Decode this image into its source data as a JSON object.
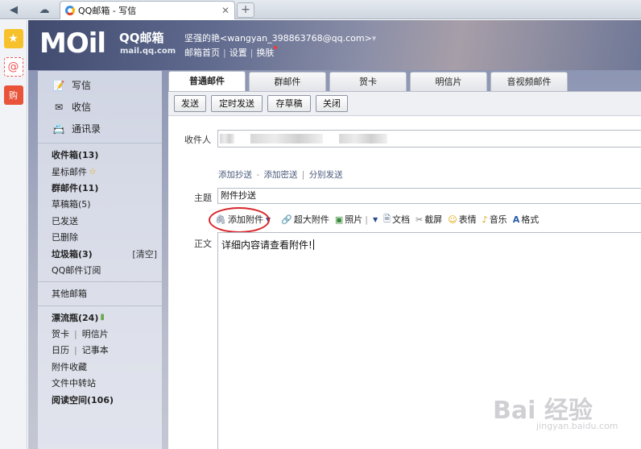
{
  "browser": {
    "tab_title": "QQ邮箱 - 写信",
    "close_glyph": "✕",
    "new_tab_glyph": "+"
  },
  "header": {
    "logo_text": "MOil",
    "brand": "QQ邮箱",
    "brand_url": "mail.qq.com",
    "user_display": "坚强的艳<wangyan_398863768@qq.com>",
    "links": [
      "邮箱首页",
      "设置",
      "换肤"
    ]
  },
  "nav": {
    "main": [
      {
        "label": "写信",
        "icon": "pencil-icon"
      },
      {
        "label": "收信",
        "icon": "inbox-icon"
      },
      {
        "label": "通讯录",
        "icon": "contacts-icon"
      }
    ],
    "folders": [
      {
        "label": "收件箱(13)",
        "bold": true
      },
      {
        "label": "星标邮件",
        "bold": false,
        "star": "☆"
      },
      {
        "label": "群邮件(11)",
        "bold": true
      },
      {
        "label": "草稿箱(5)",
        "bold": false
      },
      {
        "label": "已发送",
        "bold": false
      },
      {
        "label": "已删除",
        "bold": false
      },
      {
        "label": "垃圾箱(3)",
        "bold": true,
        "extra": "[清空]"
      },
      {
        "label": "QQ邮件订阅",
        "bold": false
      }
    ],
    "other": "其他邮箱",
    "apps": [
      {
        "label": "漂流瓶(24)",
        "bold": true
      },
      {
        "label": "贺卡",
        "label2": "明信片"
      },
      {
        "label": "日历",
        "label2": "记事本"
      },
      {
        "label": "附件收藏"
      },
      {
        "label": "文件中转站"
      },
      {
        "label": "阅读空间(106)",
        "bold": true
      }
    ]
  },
  "compose": {
    "tabs": [
      "普通邮件",
      "群邮件",
      "贺卡",
      "明信片",
      "音视频邮件"
    ],
    "actions": [
      "发送",
      "定时发送",
      "存草稿",
      "关闭"
    ],
    "to_label": "收件人",
    "to_links": [
      "添加抄送",
      "添加密送",
      "分别发送"
    ],
    "subject_label": "主题",
    "subject_value": "附件抄送",
    "toolbar": [
      {
        "label": "添加附件",
        "icon": "paperclip-icon"
      },
      {
        "label": "超大附件",
        "icon": "large-attachment-icon"
      },
      {
        "label": "照片",
        "icon": "photo-icon"
      },
      {
        "label": "文档",
        "icon": "document-icon"
      },
      {
        "label": "截屏",
        "icon": "screenshot-icon"
      },
      {
        "label": "表情",
        "icon": "emoji-icon"
      },
      {
        "label": "音乐",
        "icon": "music-icon"
      },
      {
        "label": "格式",
        "icon": "format-icon"
      }
    ],
    "body_label": "正文",
    "body_text": "详细内容请查看附件!"
  },
  "watermark": {
    "text": "Bai 经验",
    "url": "jingyan.baidu.com"
  }
}
